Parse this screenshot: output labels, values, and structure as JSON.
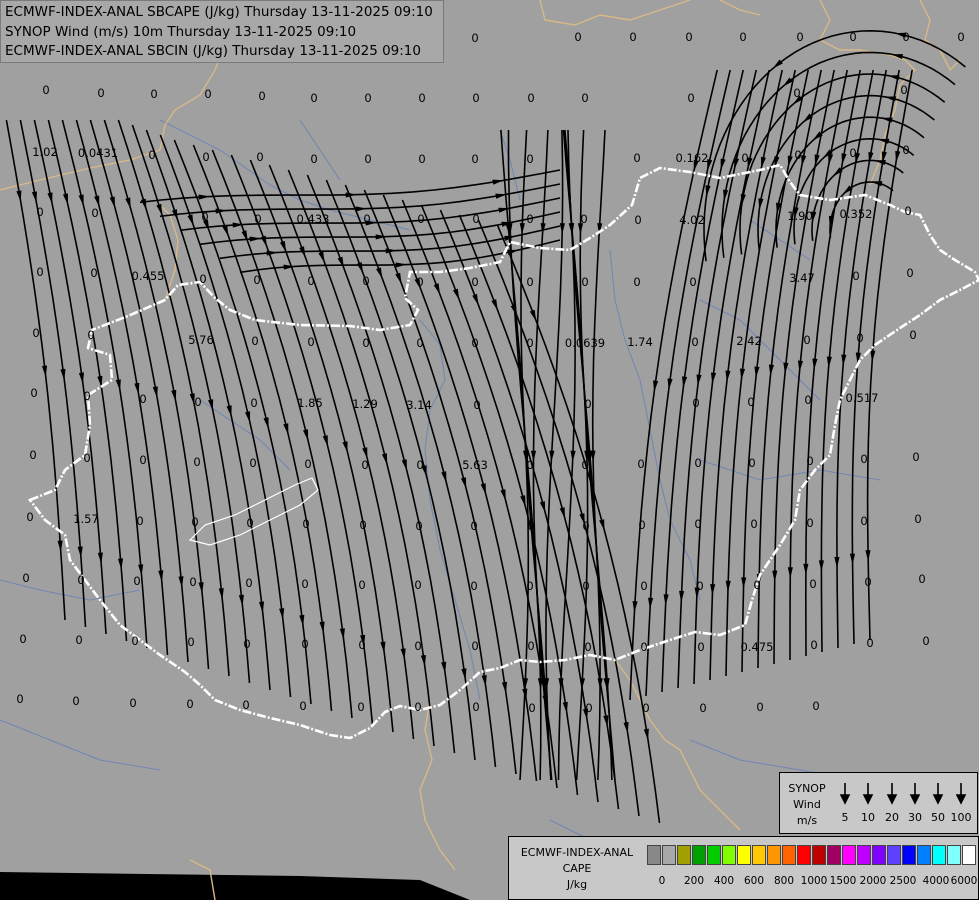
{
  "titles": [
    "ECMWF-INDEX-ANAL SBCAPE (J/kg) Thursday 13-11-2025 09:10",
    "SYNOP Wind (m/s) 10m Thursday 13-11-2025 09:10",
    "ECMWF-INDEX-ANAL SBCIN (J/kg) Thursday 13-11-2025 09:10"
  ],
  "colors": {
    "background": "#a0a0a0",
    "country_border": "#ffffff",
    "neighbor_border": "#d8b888",
    "rivers": "#6f86b4",
    "streamlines": "#000000"
  },
  "wind_legend": {
    "title_lines": [
      "SYNOP",
      "Wind",
      "m/s"
    ],
    "speeds": [
      "5",
      "10",
      "20",
      "30",
      "50",
      "100"
    ]
  },
  "cape_legend": {
    "title_lines": [
      "ECMWF-INDEX-ANAL",
      "CAPE",
      "J/kg"
    ],
    "swatches": [
      "#888888",
      "#a8a8a8",
      "#a0a000",
      "#00a000",
      "#00cc00",
      "#80ff00",
      "#ffff00",
      "#ffc800",
      "#ff9600",
      "#ff6400",
      "#ff0000",
      "#c00000",
      "#a00060",
      "#ff00ff",
      "#c000ff",
      "#8000ff",
      "#6040ff",
      "#0000ff",
      "#0080ff",
      "#00ffff",
      "#80ffff",
      "#ffffff"
    ],
    "ticks": [
      "0",
      "200",
      "400",
      "600",
      "800",
      "1000",
      "1500",
      "2000",
      "2500",
      "4000",
      "6000"
    ]
  },
  "values": [
    {
      "t": "0"
    },
    {
      "t": "0"
    },
    {
      "t": "0"
    },
    {
      "t": "0"
    },
    {
      "t": "0"
    },
    {
      "t": "0"
    },
    {
      "t": "0"
    },
    {
      "t": "0"
    },
    {
      "t": "0"
    },
    {
      "t": "0"
    },
    {
      "t": "0"
    },
    {
      "t": "0"
    },
    {
      "t": "0"
    },
    {
      "t": "0"
    },
    {
      "t": "0"
    },
    {
      "t": "0"
    },
    {
      "t": "0"
    },
    {
      "t": "0"
    },
    {
      "t": "0"
    },
    {
      "t": "0"
    },
    {
      "t": "0"
    },
    {
      "t": "0"
    },
    {
      "t": "0"
    },
    {
      "t": "1.02"
    },
    {
      "t": "0.0431"
    },
    {
      "t": "0"
    },
    {
      "t": "0"
    },
    {
      "t": "0"
    },
    {
      "t": "0"
    },
    {
      "t": "0"
    },
    {
      "t": "0"
    },
    {
      "t": "0"
    },
    {
      "t": "0"
    },
    {
      "t": "0"
    },
    {
      "t": "0.162"
    },
    {
      "t": "0"
    },
    {
      "t": "0"
    },
    {
      "t": "0"
    },
    {
      "t": "0"
    },
    {
      "t": "0"
    },
    {
      "t": "0"
    },
    {
      "t": "0"
    },
    {
      "t": "0"
    },
    {
      "t": "0.433"
    },
    {
      "t": "0"
    },
    {
      "t": "0"
    },
    {
      "t": "0"
    },
    {
      "t": "0"
    },
    {
      "t": "0"
    },
    {
      "t": "0"
    },
    {
      "t": "4.02"
    },
    {
      "t": "1.90"
    },
    {
      "t": "0.352"
    },
    {
      "t": "0"
    },
    {
      "t": "0"
    },
    {
      "t": "0"
    },
    {
      "t": "0.455"
    },
    {
      "t": "0"
    },
    {
      "t": "0"
    },
    {
      "t": "0"
    },
    {
      "t": "0"
    },
    {
      "t": "0"
    },
    {
      "t": "0"
    },
    {
      "t": "0"
    },
    {
      "t": "0"
    },
    {
      "t": "0"
    },
    {
      "t": "0"
    },
    {
      "t": "3.47"
    },
    {
      "t": "0"
    },
    {
      "t": "0"
    },
    {
      "t": "0"
    },
    {
      "t": "0"
    },
    {
      "t": "5.76"
    },
    {
      "t": "0"
    },
    {
      "t": "0"
    },
    {
      "t": "0"
    },
    {
      "t": "0"
    },
    {
      "t": "0"
    },
    {
      "t": "0"
    },
    {
      "t": "0.0639"
    },
    {
      "t": "1.74"
    },
    {
      "t": "0"
    },
    {
      "t": "2.42"
    },
    {
      "t": "0"
    },
    {
      "t": "0"
    },
    {
      "t": "0"
    },
    {
      "t": "0"
    },
    {
      "t": "0"
    },
    {
      "t": "0"
    },
    {
      "t": "0"
    },
    {
      "t": "0"
    },
    {
      "t": "1.85"
    },
    {
      "t": "1.29"
    },
    {
      "t": "3.14"
    },
    {
      "t": "0"
    },
    {
      "t": "0"
    },
    {
      "t": "0"
    },
    {
      "t": "0"
    },
    {
      "t": "0"
    },
    {
      "t": "0.517"
    },
    {
      "t": "0"
    },
    {
      "t": "0"
    },
    {
      "t": "0"
    },
    {
      "t": "0"
    },
    {
      "t": "0"
    },
    {
      "t": "0"
    },
    {
      "t": "0"
    },
    {
      "t": "0"
    },
    {
      "t": "5.63"
    },
    {
      "t": "0"
    },
    {
      "t": "0"
    },
    {
      "t": "0"
    },
    {
      "t": "0"
    },
    {
      "t": "0"
    },
    {
      "t": "0"
    },
    {
      "t": "0"
    },
    {
      "t": "0"
    },
    {
      "t": "0"
    },
    {
      "t": "1.57"
    },
    {
      "t": "0"
    },
    {
      "t": "0"
    },
    {
      "t": "0"
    },
    {
      "t": "0"
    },
    {
      "t": "0"
    },
    {
      "t": "0"
    },
    {
      "t": "0"
    },
    {
      "t": "0"
    },
    {
      "t": "0"
    },
    {
      "t": "0"
    },
    {
      "t": "0"
    },
    {
      "t": "0"
    },
    {
      "t": "0"
    },
    {
      "t": "0"
    },
    {
      "t": "0"
    },
    {
      "t": "0"
    },
    {
      "t": "0"
    },
    {
      "t": "0"
    },
    {
      "t": "0"
    },
    {
      "t": "0"
    },
    {
      "t": "0"
    },
    {
      "t": "0"
    },
    {
      "t": "0"
    },
    {
      "t": "0"
    },
    {
      "t": "0"
    },
    {
      "t": "0"
    },
    {
      "t": "0"
    },
    {
      "t": "0"
    },
    {
      "t": "0"
    },
    {
      "t": "0"
    },
    {
      "t": "0"
    },
    {
      "t": "0"
    },
    {
      "t": "0"
    },
    {
      "t": "0"
    },
    {
      "t": "0"
    },
    {
      "t": "0"
    },
    {
      "t": "0"
    },
    {
      "t": "0"
    },
    {
      "t": "0"
    },
    {
      "t": "0"
    },
    {
      "t": "0"
    },
    {
      "t": "0"
    },
    {
      "t": "0"
    },
    {
      "t": "0"
    },
    {
      "t": "0"
    },
    {
      "t": "0.475"
    },
    {
      "t": "0"
    },
    {
      "t": "0"
    },
    {
      "t": "0"
    },
    {
      "t": "0"
    },
    {
      "t": "0"
    },
    {
      "t": "0"
    },
    {
      "t": "0"
    },
    {
      "t": "0"
    },
    {
      "t": "0"
    },
    {
      "t": "0"
    },
    {
      "t": "0"
    },
    {
      "t": "0"
    },
    {
      "t": "0"
    },
    {
      "t": "0"
    },
    {
      "t": "0"
    },
    {
      "t": "0"
    },
    {
      "t": "0"
    },
    {
      "t": "0"
    }
  ]
}
